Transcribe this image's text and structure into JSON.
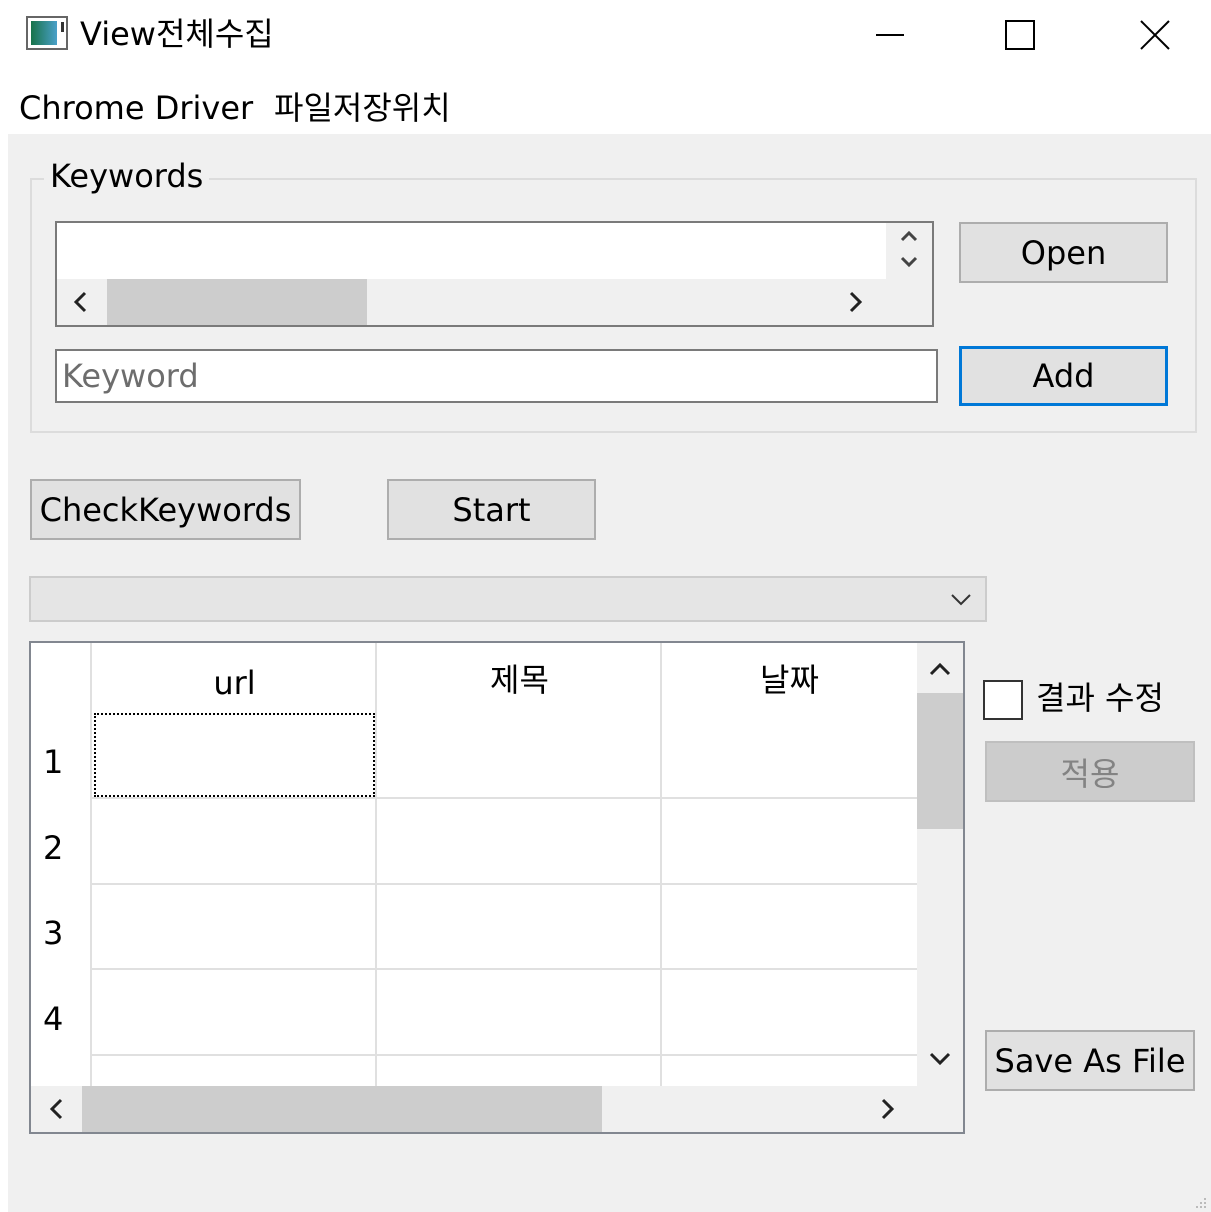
{
  "window": {
    "title": "View전체수집",
    "icon": "app-window-icon",
    "controls": {
      "minimize": "minimize-icon",
      "maximize": "maximize-icon",
      "close": "close-icon"
    }
  },
  "menu": {
    "items": [
      {
        "label": "Chrome Driver"
      },
      {
        "label": "파일저장위치"
      }
    ]
  },
  "keywords": {
    "group_label": "Keywords",
    "open_label": "Open",
    "add_label": "Add",
    "input_placeholder": "Keyword",
    "input_value": ""
  },
  "actions": {
    "check_keywords_label": "CheckKeywords",
    "start_label": "Start"
  },
  "combo": {
    "selected": ""
  },
  "grid": {
    "columns": [
      "url",
      "제목",
      "날짜"
    ],
    "rows": [
      {
        "num": "1",
        "cells": [
          "",
          "",
          ""
        ]
      },
      {
        "num": "2",
        "cells": [
          "",
          "",
          ""
        ]
      },
      {
        "num": "3",
        "cells": [
          "",
          "",
          ""
        ]
      },
      {
        "num": "4",
        "cells": [
          "",
          "",
          ""
        ]
      }
    ]
  },
  "edit": {
    "checkbox_label": "결과 수정",
    "checked": false,
    "apply_label": "적용",
    "save_label": "Save As File"
  },
  "colors": {
    "focus_border": "#0078d7",
    "background": "#f0f0f0",
    "button": "#e1e1e1"
  }
}
